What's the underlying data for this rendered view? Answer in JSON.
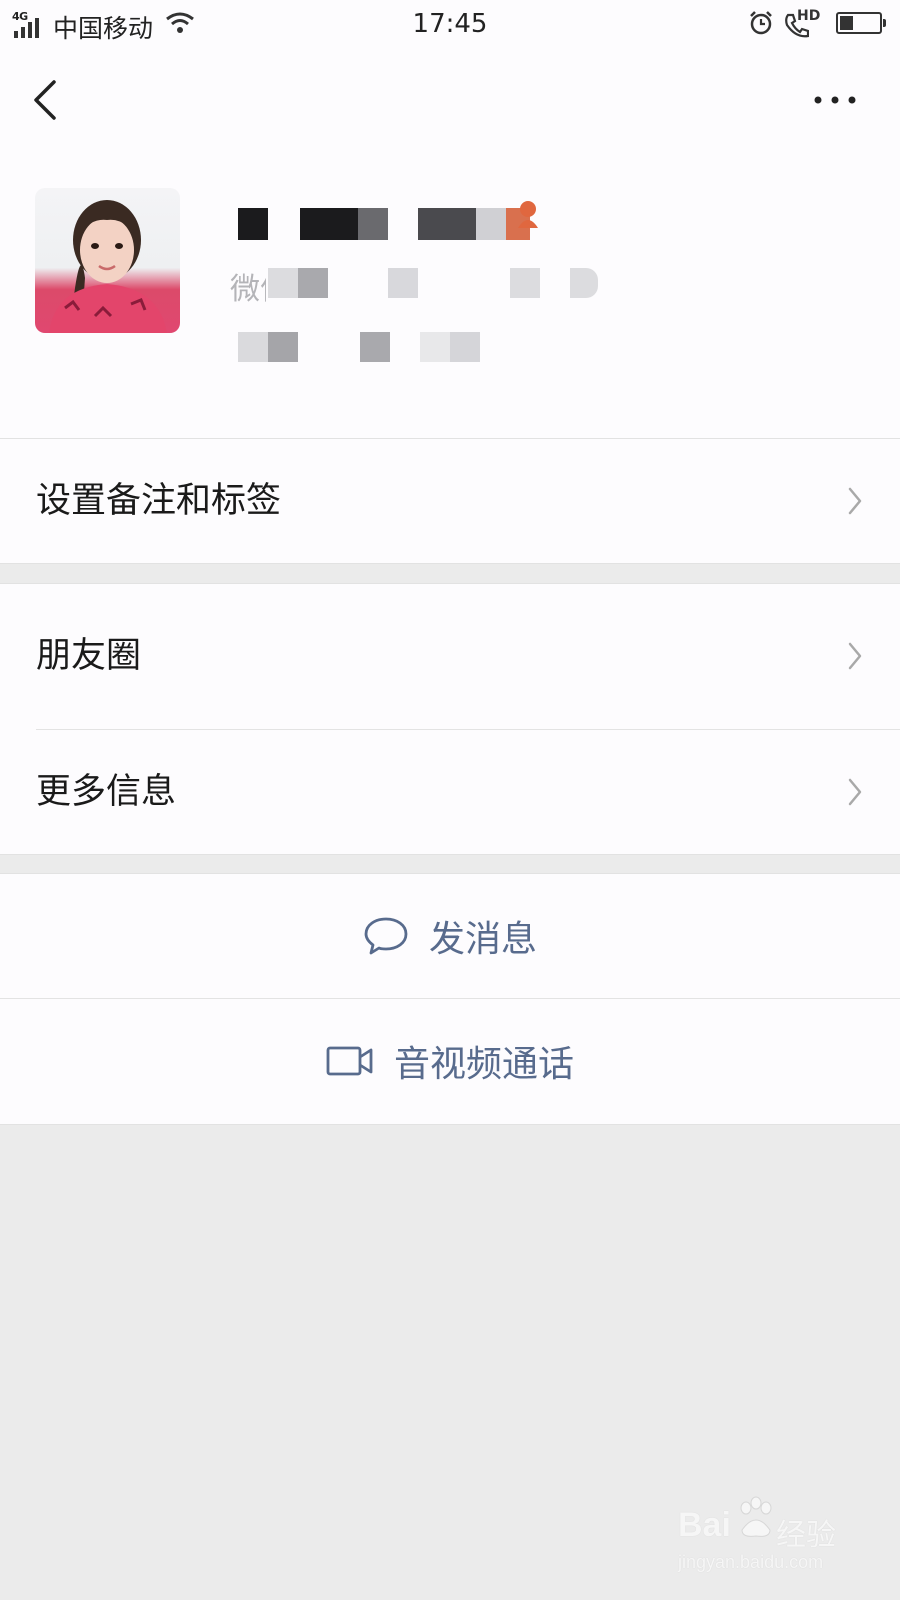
{
  "status_bar": {
    "network": "4G",
    "carrier": "中国移动",
    "time": "17:45",
    "hd_label": "HD",
    "battery_level": 0.35
  },
  "header": {
    "back_icon": "chevron-left-icon",
    "more_icon": "more-dots-icon"
  },
  "profile": {
    "avatar": "avatar",
    "name_obscured": true,
    "wechat_id_label": "微信号",
    "region_obscured": true
  },
  "menu": {
    "remark_tags": "设置备注和标签",
    "moments": "朋友圈",
    "more_info": "更多信息"
  },
  "actions": {
    "send_message": "发消息",
    "video_call": "音视频通话"
  },
  "watermark": {
    "brand": "Bai",
    "brand_suffix": "经验",
    "url": "jingyan.baidu.com"
  },
  "colors": {
    "action_text": "#586b8d",
    "page_bg": "#ebebeb",
    "card_bg": "#fdfcfe"
  }
}
